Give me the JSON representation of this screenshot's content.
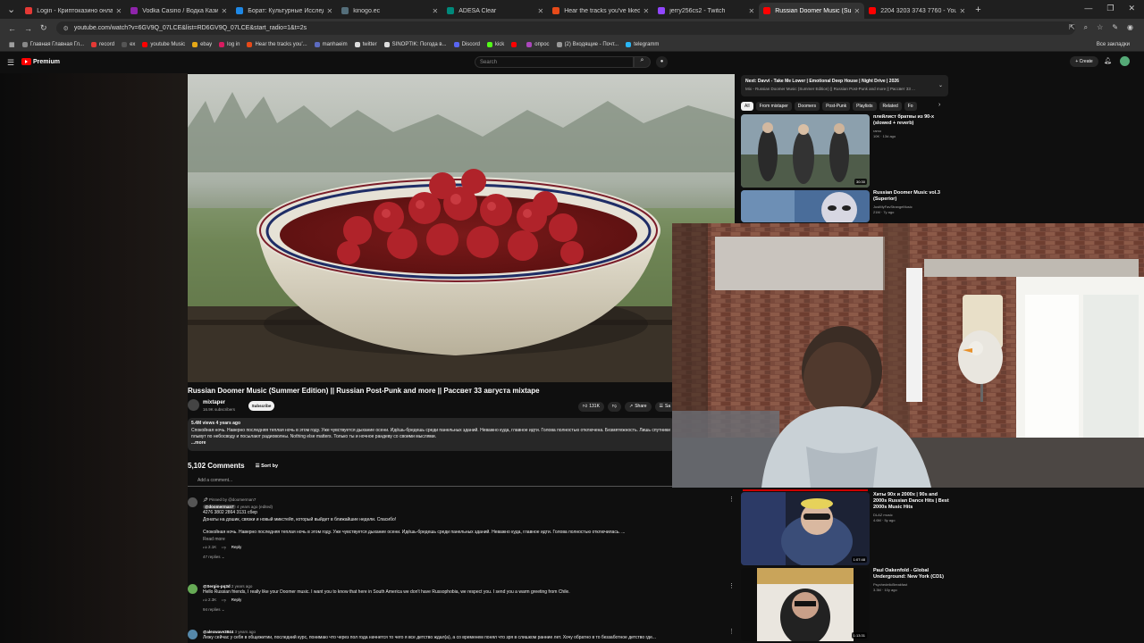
{
  "browser": {
    "tabs": [
      {
        "title": "Login - Криптоказино онлайн",
        "color": "#e53935"
      },
      {
        "title": "Vodka Casino / Водка Казино",
        "color": "#8e24aa"
      },
      {
        "title": "Борат: Культурные Исследов...",
        "color": "#1e88e5"
      },
      {
        "title": "kinogo.ec",
        "color": "#546e7a"
      },
      {
        "title": "ADESA Clear",
        "color": "#00897b"
      },
      {
        "title": "Hear the tracks you've liked: o...",
        "color": "#e64a19"
      },
      {
        "title": "jerry256cs2 - Twitch",
        "color": "#9146ff"
      },
      {
        "title": "Russian Doomer Music (Summ...",
        "color": "#ff0000"
      },
      {
        "title": "2204 3203 3743 7760 - YouTub...",
        "color": "#ff0000"
      }
    ],
    "active_tab": 7,
    "url": "youtube.com/watch?v=6GV9Q_07LCE&list=RD6GV9Q_07LCE&start_radio=1&t=2s",
    "bookmarks": [
      "Главная Главная Гл...",
      "record",
      "ex",
      "youtube Music",
      "ebay",
      "log in",
      "Hear the tracks you'...",
      "manhaeim",
      "twitter",
      "SINOPTIK: Погода в...",
      "Discord",
      "kick",
      "",
      "опрос",
      "(2) Входящие - Почт...",
      "telegramm"
    ],
    "all_bookmarks": "Все закладки"
  },
  "youtube": {
    "logo_text": "Premium",
    "search_placeholder": "Search",
    "create_label": "Create"
  },
  "video": {
    "title": "Russian Doomer Music (Summer Edition) || Russian Post-Punk and more || Рассвет 33 августа mixtape",
    "channel": "mixtaper",
    "subscribers": "16.9K subscribers",
    "subscribe_label": "Subscribe",
    "likes": "131K",
    "share_label": "Share",
    "save_label": "Sa",
    "views_date": "5.4M views  4 years ago",
    "description": "Спокойная ночь. Наверно последняя теплая ночь в этом году. Уже чувствуется дыхание осени. Идёшь-бредешь среди панельных зданий. Неважно куда, главное идти. Голова полностью отключена. Безмятежность. Лишь спутники плывут по небосводу и посылают радиоволны. Nothing else matters. Только ты и ночное рандеву со своими мыслями.",
    "more_label": "...more"
  },
  "comments": {
    "count": "5,102 Comments",
    "sort_label": "Sort by",
    "add_placeholder": "Add a comment...",
    "items": [
      {
        "pinned": "Pinned by @doomerman7",
        "author": "@doomerman7",
        "meta": "4 years ago (edited)",
        "lines": [
          "4276 3802 2864 3131 сбер",
          "Донаты на дошик, связки и новый микстейп, который выйдет в ближайшие недели. Спасибо!",
          "",
          "Спокойная ночь. Наверно последняя теплая ночь в этом году. Уже чувствуется дыхание осени. Идёшь-бредешь среди панельных зданий. Неважно куда, главное идти. Голова полностью отключилась. ..."
        ],
        "read_more": "Read more",
        "likes": "2.1K",
        "reply": "Reply",
        "replies": "47 replies"
      },
      {
        "author": "@Sergio-pq3d",
        "meta": "2 years ago",
        "lines": [
          "Hello Russian friends, I really like your Doomer music. I want you to know that here in South America we don't have Russophobia, we respect you. I send you a warm greeting from Chile."
        ],
        "likes": "2.3K",
        "reply": "Reply",
        "replies": "94 replies"
      },
      {
        "author": "@alexwave3844",
        "meta": "3 years ago",
        "lines": [
          "Лежу сейчас у себя в общежитии, последний курс, понимаю что через пол года начнется то чего я все детство ждал(а), а со временем понял что зря в слишком ранние лет. Хочу обратно в то беззаботное детство где..."
        ]
      }
    ]
  },
  "sidebar": {
    "next_title": "Next: Davvi - Take Me Lower | Emotional Deep House | Night Drive | 2026",
    "next_sub": "Mix - Russian Doomer Music (Summer Edition) || Russian Post-Punk and more || Рассвет 33 ...",
    "chips": [
      "All",
      "From mixtaper",
      "Doomers",
      "Post-Punk",
      "Playlists",
      "Related",
      "Fo"
    ],
    "recs": [
      {
        "title": "плейлист братвы из 90-х (slowed + reverb)",
        "channel": "ramo",
        "meta": "10K · 13d ago",
        "duration": "30:30"
      },
      {
        "title": "Russian Doomer Music vol.3 (Superior)",
        "channel": "JustMyFavStrangeMusic",
        "meta": "21M · 7y ago",
        "duration": ""
      },
      {
        "title": "Хиты 90х и 2000х | 90s and 2000s Russian Dance Hits | Best 2000s Music Hits",
        "channel": "DLAZ music",
        "meta": "4.6M · 5y ago",
        "duration": "1:07:48"
      },
      {
        "title": "Paul Oakenfold - Global Underground: New York (CD1)",
        "channel": "PsychedelicBreakfast",
        "meta": "3.3M · 10y ago",
        "duration": "1:13:31"
      }
    ]
  },
  "colors": {
    "accent": "#ff0000",
    "background": "#0f0f0f",
    "panel": "#272727"
  },
  "icons": [
    "menu-icon",
    "search-icon",
    "mic-icon",
    "bell-icon",
    "like-icon",
    "dislike-icon",
    "share-icon",
    "sort-icon",
    "more-vert-icon",
    "chevron-down-icon"
  ]
}
